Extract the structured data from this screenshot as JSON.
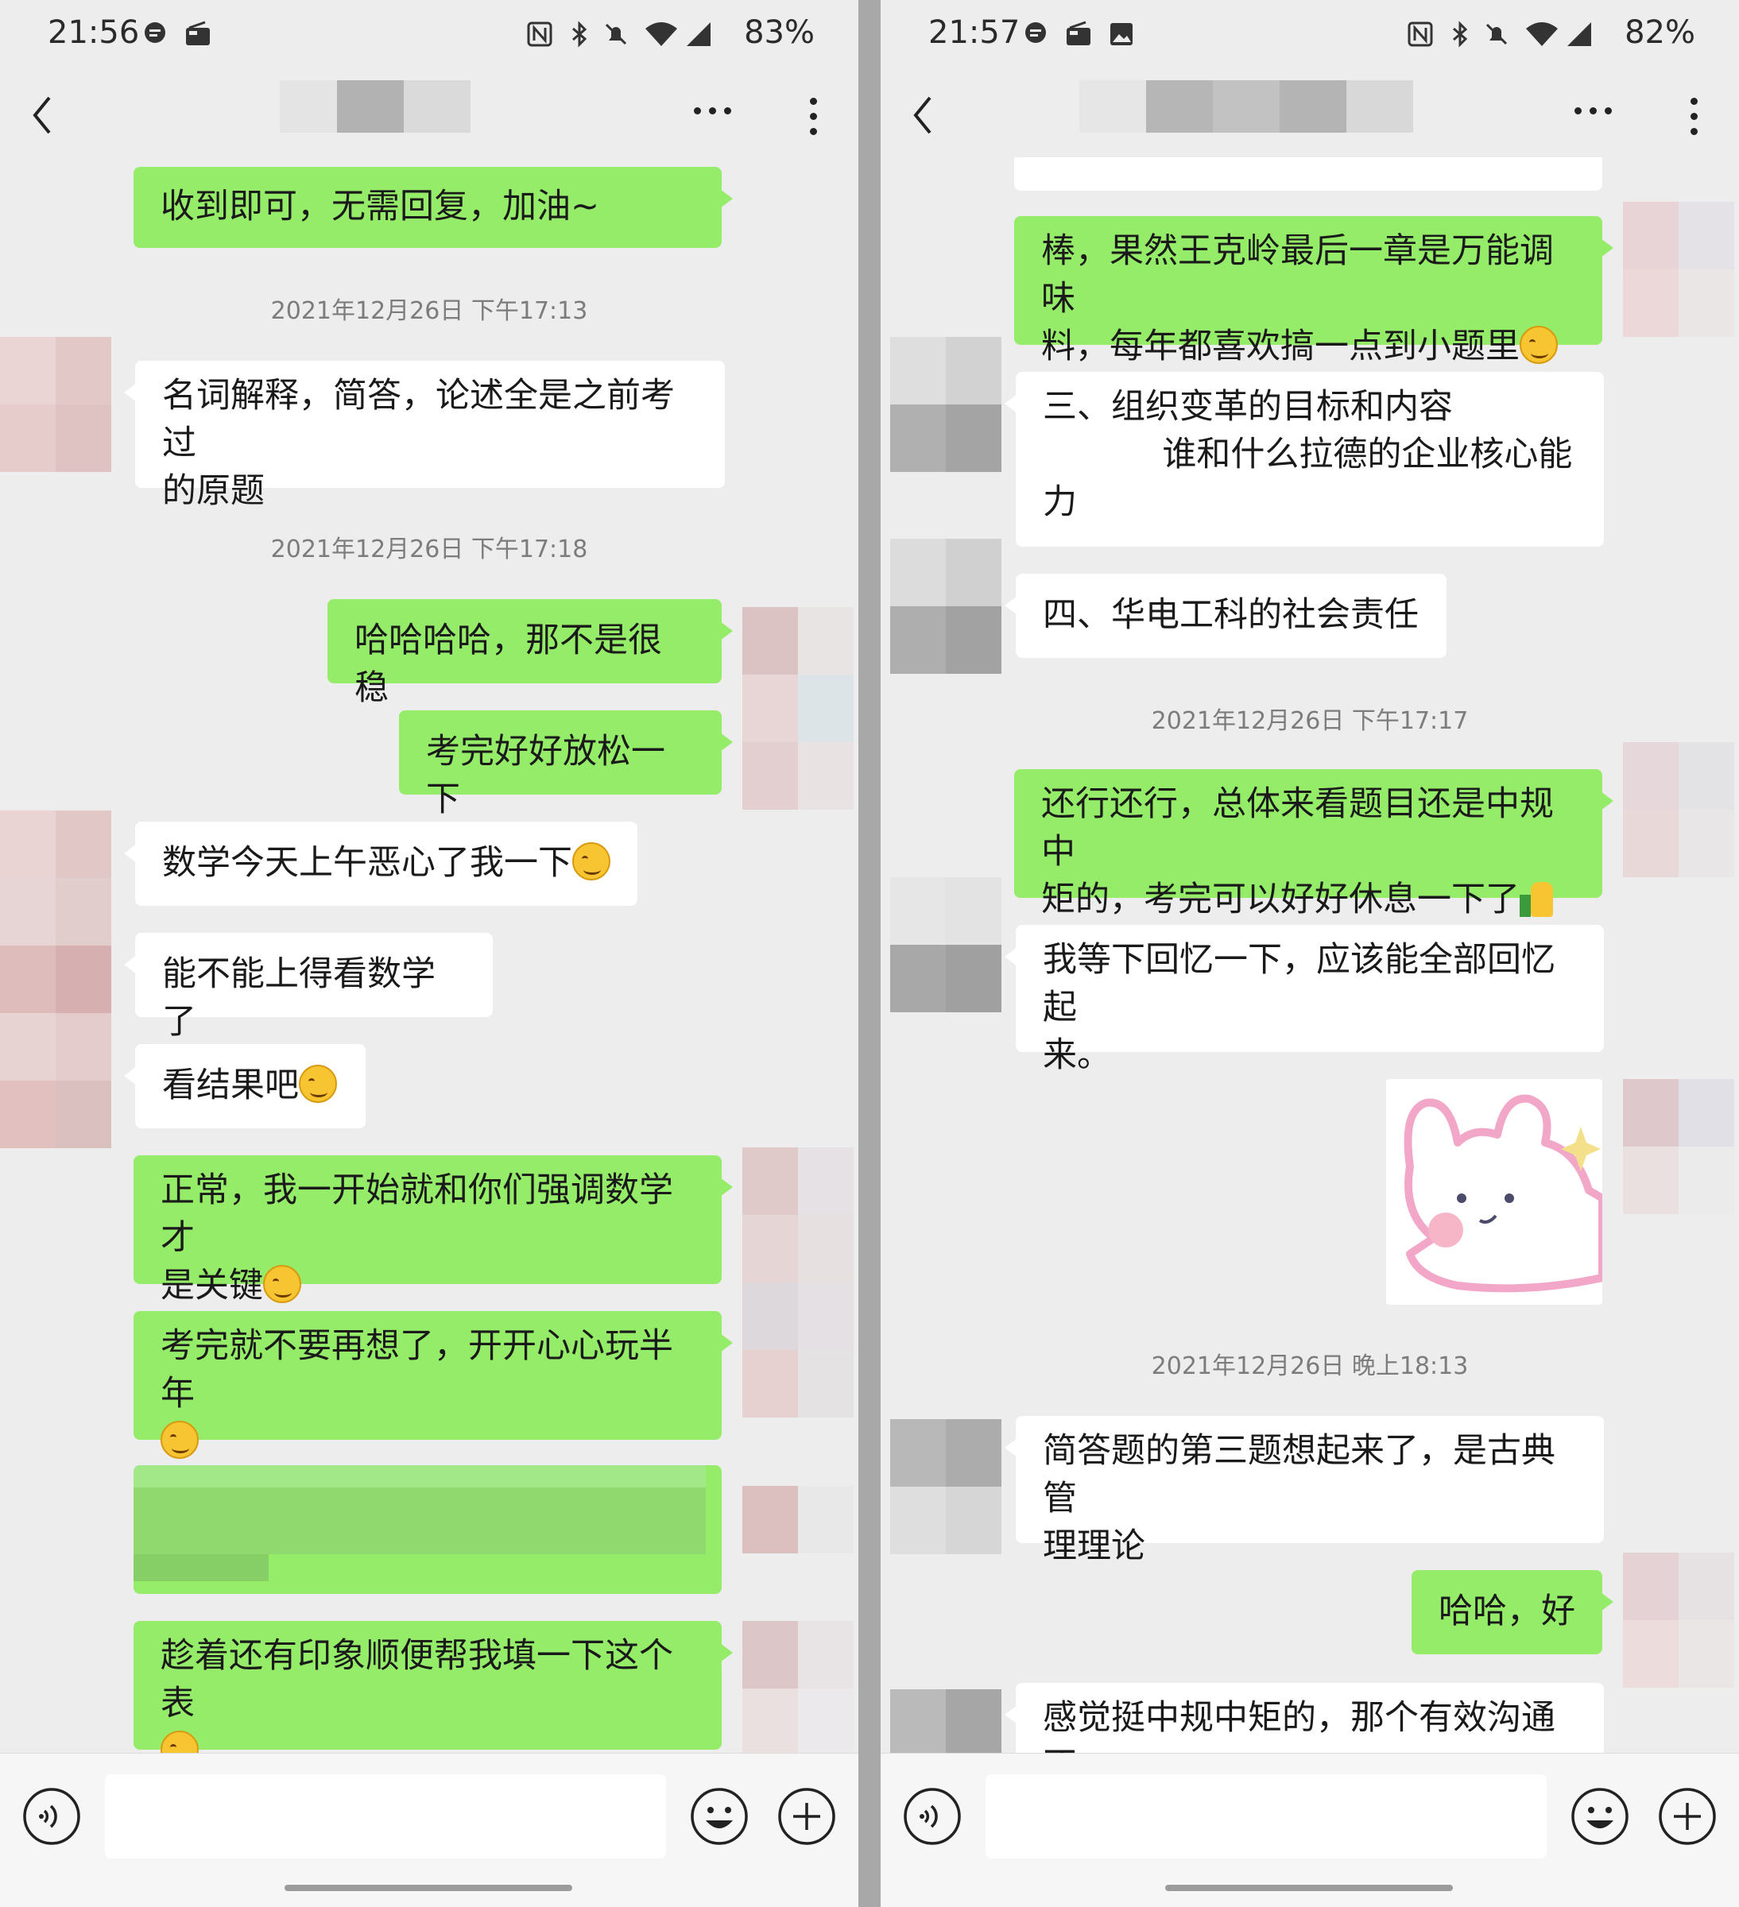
{
  "left": {
    "status": {
      "time": "21:56",
      "battery": "83%"
    },
    "messages": {
      "m1": "收到即可，无需回复，加油~",
      "ts1": "2021年12月26日 下午17:13",
      "m2": "名词解释，简答，论述全是之前考过\n的原题",
      "ts2": "2021年12月26日 下午17:18",
      "m3": "哈哈哈哈，那不是很稳",
      "m4": "考完好好放松一下",
      "m5": "数学今天上午恶心了我一下",
      "m6": "能不能上得看数学了",
      "m7": "看结果吧",
      "m8": "正常，我一开始就和你们强调数学才\n是关键",
      "m9": "考完就不要再想了，开开心心玩半年",
      "m10": "趁着还有印象顺便帮我填一下这个表"
    }
  },
  "right": {
    "status": {
      "time": "21:57",
      "battery": "82%"
    },
    "messages": {
      "r1": "棒，果然王克岭最后一章是万能调味\n料，每年都喜欢搞一点到小题里",
      "r2": "三、组织变革的目标和内容\n           谁和什么拉德的企业核心能\n力",
      "r3": "四、华电工科的社会责任",
      "ts1": "2021年12月26日 下午17:17",
      "r4": "还行还行，总体来看题目还是中规中\n矩的，考完可以好好休息一下了",
      "r5": "我等下回忆一下，应该能全部回忆起\n来。",
      "ts2": "2021年12月26日 晚上18:13",
      "r6": "简答题的第三题想起来了，是古典管\n理理论",
      "r7": "哈哈，好",
      "r8": "感觉挺中规中矩的，那个有效沟通不"
    }
  },
  "icons": {
    "status_left": [
      "message-icon",
      "radio-icon"
    ],
    "status_right": [
      "nfc-icon",
      "bluetooth-icon",
      "mute-icon",
      "wifi-icon",
      "signal-icon"
    ],
    "nav": [
      "back-icon",
      "more-icon",
      "kebab-icon"
    ],
    "input": [
      "voice-icon",
      "emoji-icon",
      "plus-icon"
    ]
  },
  "colors": {
    "my_bubble": "#95ec69",
    "their_bubble": "#ffffff",
    "background": "#ededed",
    "divider": "#a8a8a8"
  }
}
